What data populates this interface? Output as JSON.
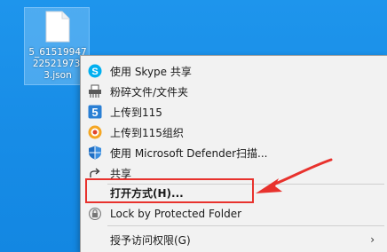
{
  "desktop": {
    "file": {
      "name": "5_6151994722521973l3.json",
      "name_line1": "5_61519947",
      "name_line2": "22521973l",
      "name_line3": "3.json"
    }
  },
  "context_menu": {
    "items": [
      {
        "label": "使用 Skype 共享",
        "icon": "skype-icon"
      },
      {
        "label": "粉碎文件/文件夹",
        "icon": "shredder-icon"
      },
      {
        "label": "上传到115",
        "icon": "upload-115-icon"
      },
      {
        "label": "上传到115组织",
        "icon": "upload-115-org-icon"
      },
      {
        "label": "使用 Microsoft Defender扫描...",
        "icon": "defender-shield-icon"
      },
      {
        "label": "共享",
        "icon": "share-icon"
      },
      {
        "label": "打开方式(H)...",
        "icon": null
      },
      {
        "label": "Lock by Protected Folder",
        "icon": "lock-folder-icon"
      },
      {
        "label": "授予访问权限(G)",
        "icon": null,
        "has_submenu": true
      }
    ]
  },
  "annotation": {
    "highlight_color": "#e8322d"
  },
  "colors": {
    "desktop_bg": "#1b8ee8",
    "menu_bg": "#f2f2f2",
    "skype_blue": "#00aff0",
    "upload_blue": "#2a7fd4",
    "defender_blue": "#1f6fc4"
  }
}
